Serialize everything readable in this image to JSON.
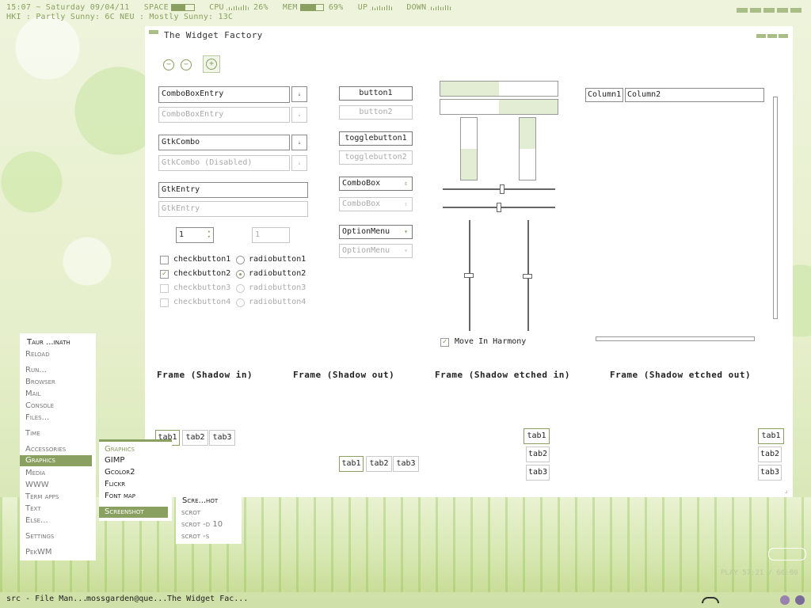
{
  "statusbar": {
    "datetime": "15:07 ~ Saturday 09/04/11",
    "space_label": "SPACE",
    "space_pct": 0.6,
    "cpu_label": "CPU",
    "cpu_value": "26%",
    "mem_label": "MEM",
    "mem_value": "69%",
    "mem_pct": 0.69,
    "up_label": "UP",
    "down_label": "DOWN",
    "weather": "HKI : Partly Sunny: 6C   NEU : Mostly Sunny: 13C",
    "accent": "#8aa060"
  },
  "window": {
    "title": "The Widget Factory",
    "toolbar_icons": [
      "back-icon",
      "forward-icon",
      "add-icon"
    ],
    "combos": {
      "cbentry": "ComboBoxEntry",
      "cbentry_dis": "ComboBoxEntry",
      "gtkcombo": "GtkCombo",
      "gtkcombo_dis": "GtkCombo (Disabled)",
      "gtkentry": "GtkEntry",
      "gtkentry_dis": "GtkEntry",
      "spin1": "1",
      "spin2": "1"
    },
    "checks": [
      {
        "label": "checkbutton1",
        "checked": false,
        "disabled": false
      },
      {
        "label": "checkbutton2",
        "checked": true,
        "disabled": false
      },
      {
        "label": "checkbutton3",
        "checked": false,
        "disabled": true
      },
      {
        "label": "checkbutton4",
        "checked": false,
        "disabled": true
      }
    ],
    "radios": [
      {
        "label": "radiobutton1",
        "checked": false,
        "disabled": false
      },
      {
        "label": "radiobutton2",
        "checked": true,
        "disabled": false
      },
      {
        "label": "radiobutton3",
        "checked": false,
        "disabled": true
      },
      {
        "label": "radiobutton4",
        "checked": false,
        "disabled": true
      }
    ],
    "buttons": {
      "button1": "button1",
      "button2": "button2",
      "toggle1": "togglebutton1",
      "toggle2": "togglebutton2",
      "combobox": "ComboBox",
      "combobox_dis": "ComboBox",
      "optionmenu": "OptionMenu",
      "optionmenu_dis": "OptionMenu"
    },
    "progress": {
      "h1": 0.5,
      "h2": 0.5,
      "v1": 0.5,
      "v2": 0.5
    },
    "harmony_label": "Move In Harmony",
    "columns": [
      "Column1",
      "Column2"
    ],
    "frames": [
      "Frame (Shadow in)",
      "Frame (Shadow out)",
      "Frame (Shadow etched in)",
      "Frame (Shadow etched out)"
    ],
    "tabs": [
      "tab1",
      "tab2",
      "tab3"
    ]
  },
  "menu": {
    "items": [
      "Taur ...inath",
      "Reload",
      "Run...",
      "Browser",
      "Mail",
      "Console",
      "Files...",
      "Time",
      "Accessories",
      "Graphics",
      "Media",
      "WWW",
      "Term apps",
      "Text",
      "Else...",
      "Settings",
      "PekWM"
    ],
    "submenu_title": "Graphics",
    "submenu": [
      "GIMP",
      "Gcolor2",
      "Flickr",
      "Font map",
      "Screenshot"
    ],
    "subsubmenu": [
      "Scre...hot",
      "scrot",
      "scrot -d 10",
      "scrot -s"
    ]
  },
  "taskbar": {
    "tasks": [
      "src - File Man...",
      "mossgarden@que...",
      "The Widget Fac..."
    ]
  },
  "player": {
    "text": "PLAY 57:21 / 60:00"
  }
}
